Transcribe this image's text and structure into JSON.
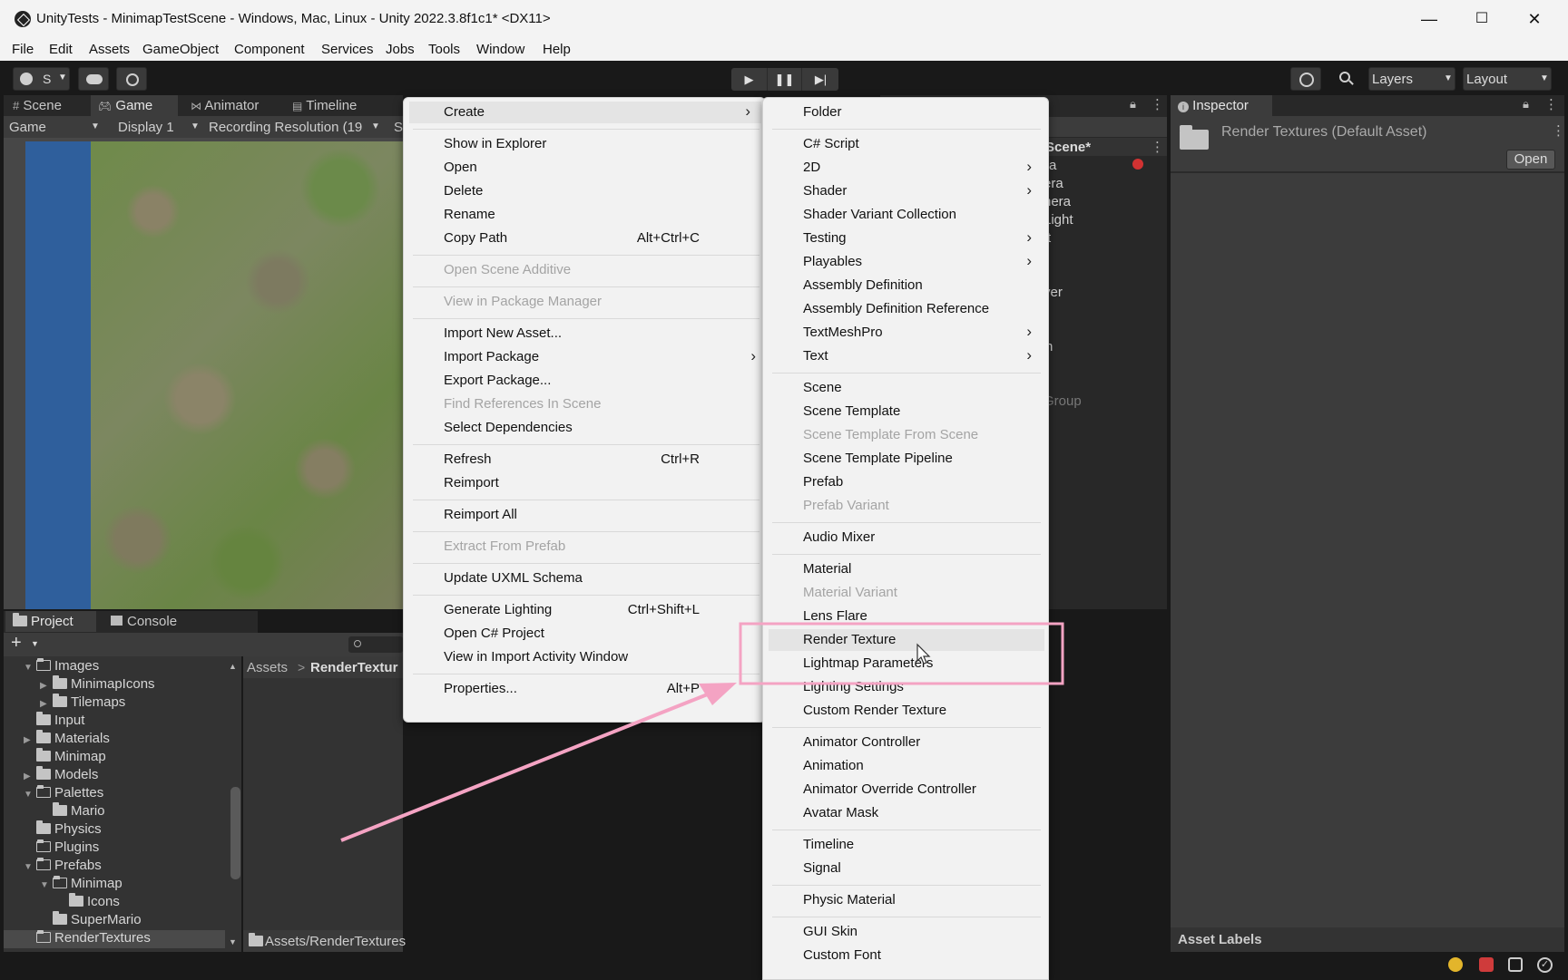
{
  "window": {
    "title": "UnityTests - MinimapTestScene - Windows, Mac, Linux - Unity 2022.3.8f1c1* <DX11>",
    "controls": {
      "minimize": "—",
      "maximize": "☐",
      "close": "✕"
    }
  },
  "menubar": [
    "File",
    "Edit",
    "Assets",
    "GameObject",
    "Component",
    "Services",
    "Jobs",
    "Tools",
    "Window",
    "Help"
  ],
  "toolbar": {
    "account": "S",
    "layers": "Layers",
    "layout": "Layout"
  },
  "scene_tabs": [
    "Scene",
    "Game",
    "Animator",
    "Timeline"
  ],
  "game_bar": {
    "mode": "Game",
    "display": "Display 1",
    "resolution": "Recording Resolution (19",
    "scale_prefix": "S"
  },
  "hierarchy_fragments": [
    "Scene*",
    "a",
    "era",
    "nera",
    "Light",
    "t",
    "yer",
    "n",
    "Group"
  ],
  "project": {
    "tabs": [
      "Project",
      "Console"
    ],
    "add": "+",
    "tree": [
      {
        "label": "Images",
        "depth": 1,
        "expanded": true
      },
      {
        "label": "MinimapIcons",
        "depth": 2,
        "expanded": false
      },
      {
        "label": "Tilemaps",
        "depth": 2,
        "expanded": false
      },
      {
        "label": "Input",
        "depth": 1
      },
      {
        "label": "Materials",
        "depth": 1,
        "expanded": false
      },
      {
        "label": "Minimap",
        "depth": 1
      },
      {
        "label": "Models",
        "depth": 1,
        "expanded": false
      },
      {
        "label": "Palettes",
        "depth": 1,
        "expanded": true
      },
      {
        "label": "Mario",
        "depth": 2
      },
      {
        "label": "Physics",
        "depth": 1
      },
      {
        "label": "Plugins",
        "depth": 1
      },
      {
        "label": "Prefabs",
        "depth": 1,
        "expanded": true
      },
      {
        "label": "Minimap",
        "depth": 2,
        "expanded": true
      },
      {
        "label": "Icons",
        "depth": 3
      },
      {
        "label": "SuperMario",
        "depth": 2
      },
      {
        "label": "RenderTextures",
        "depth": 1,
        "selected": true
      }
    ],
    "breadcrumb_root": "Assets",
    "breadcrumb_current": "RenderTextur",
    "footer_path": "Assets/RenderTextures"
  },
  "context_menu": {
    "groups": [
      [
        {
          "label": "Create",
          "submenu": true,
          "highlighted": true
        }
      ],
      [
        {
          "label": "Show in Explorer"
        },
        {
          "label": "Open"
        },
        {
          "label": "Delete"
        },
        {
          "label": "Rename"
        },
        {
          "label": "Copy Path",
          "shortcut": "Alt+Ctrl+C"
        }
      ],
      [
        {
          "label": "Open Scene Additive",
          "disabled": true
        }
      ],
      [
        {
          "label": "View in Package Manager",
          "disabled": true
        }
      ],
      [
        {
          "label": "Import New Asset..."
        },
        {
          "label": "Import Package",
          "submenu": true
        },
        {
          "label": "Export Package..."
        },
        {
          "label": "Find References In Scene",
          "disabled": true
        },
        {
          "label": "Select Dependencies"
        }
      ],
      [
        {
          "label": "Refresh",
          "shortcut": "Ctrl+R"
        },
        {
          "label": "Reimport"
        }
      ],
      [
        {
          "label": "Reimport All"
        }
      ],
      [
        {
          "label": "Extract From Prefab",
          "disabled": true
        }
      ],
      [
        {
          "label": "Update UXML Schema"
        }
      ],
      [
        {
          "label": "Generate Lighting",
          "shortcut": "Ctrl+Shift+L"
        },
        {
          "label": "Open C# Project"
        },
        {
          "label": "View in Import Activity Window"
        }
      ],
      [
        {
          "label": "Properties...",
          "shortcut": "Alt+P"
        }
      ]
    ]
  },
  "create_submenu": {
    "groups": [
      [
        {
          "label": "Folder"
        }
      ],
      [
        {
          "label": "C# Script"
        },
        {
          "label": "2D",
          "submenu": true
        },
        {
          "label": "Shader",
          "submenu": true
        },
        {
          "label": "Shader Variant Collection"
        },
        {
          "label": "Testing",
          "submenu": true
        },
        {
          "label": "Playables",
          "submenu": true
        },
        {
          "label": "Assembly Definition"
        },
        {
          "label": "Assembly Definition Reference"
        },
        {
          "label": "TextMeshPro",
          "submenu": true
        },
        {
          "label": "Text",
          "submenu": true
        }
      ],
      [
        {
          "label": "Scene"
        },
        {
          "label": "Scene Template"
        },
        {
          "label": "Scene Template From Scene",
          "disabled": true
        },
        {
          "label": "Scene Template Pipeline"
        },
        {
          "label": "Prefab"
        },
        {
          "label": "Prefab Variant",
          "disabled": true
        }
      ],
      [
        {
          "label": "Audio Mixer"
        }
      ],
      [
        {
          "label": "Material"
        },
        {
          "label": "Material Variant",
          "disabled": true
        },
        {
          "label": "Lens Flare"
        },
        {
          "label": "Render Texture",
          "highlighted": true
        },
        {
          "label": "Lightmap Parameters"
        },
        {
          "label": "Lighting Settings"
        },
        {
          "label": "Custom Render Texture"
        }
      ],
      [
        {
          "label": "Animator Controller"
        },
        {
          "label": "Animation"
        },
        {
          "label": "Animator Override Controller"
        },
        {
          "label": "Avatar Mask"
        }
      ],
      [
        {
          "label": "Timeline"
        },
        {
          "label": "Signal"
        }
      ],
      [
        {
          "label": "Physic Material"
        }
      ],
      [
        {
          "label": "GUI Skin"
        },
        {
          "label": "Custom Font"
        }
      ]
    ]
  },
  "inspector": {
    "tab": "Inspector",
    "asset_title": "Render Textures (Default Asset)",
    "open_button": "Open",
    "asset_labels": "Asset Labels"
  },
  "colors": {
    "annotation": "#f4a3c3",
    "grass": "#6f8a4a",
    "water": "#2f5f9c"
  }
}
